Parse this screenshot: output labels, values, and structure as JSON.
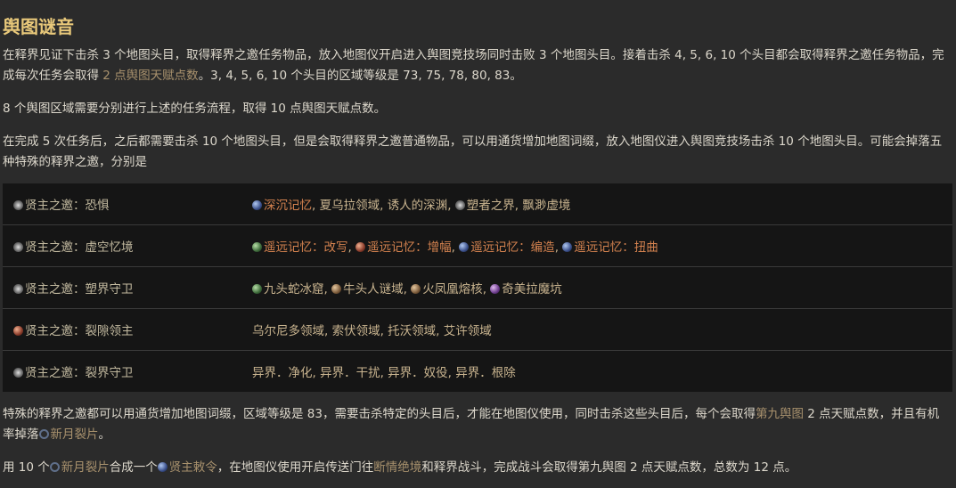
{
  "title": "舆图谜音",
  "para1": {
    "t1": "在释界见证下击杀 3 个地图头目，取得释界之邀任务物品，放入地图仪开启进入舆图竞技场同时击败 3 个地图头目。接着击杀 4, 5, 6, 10 个头目都会取得释界之邀任务物品，完成每次任务会取得 ",
    "hl": "2 点舆图天赋点数",
    "t2": "。3, 4, 5, 6, 10 个头目的区域等级是 73, 75, 78, 80, 83。"
  },
  "para2": "8 个舆图区域需要分别进行上述的任务流程，取得 10 点舆图天赋点数。",
  "para3": "在完成 5 次任务后，之后都需要击杀 10 个地图头目，但是会取得释界之邀普通物品，可以用通货增加地图词缀，放入地图仪进入舆图竞技场击杀 10 个地图头目。可能会掉落五种特殊的释界之邀，分别是",
  "table": {
    "rows": [
      {
        "name": "贤主之邀：恐惧",
        "items": [
          {
            "text": "深沉记忆",
            "style": "orange",
            "icon": "blue"
          },
          {
            "text": ", ",
            "style": "plain",
            "icon": ""
          },
          {
            "text": "夏乌拉领域",
            "style": "plain",
            "icon": ""
          },
          {
            "text": ", ",
            "style": "plain",
            "icon": ""
          },
          {
            "text": "诱人的深渊",
            "style": "plain",
            "icon": ""
          },
          {
            "text": ", ",
            "style": "plain",
            "icon": ""
          },
          {
            "text": "塑者之界",
            "style": "plain",
            "icon": "star"
          },
          {
            "text": ", ",
            "style": "plain",
            "icon": ""
          },
          {
            "text": "飘渺虚境",
            "style": "plain",
            "icon": ""
          }
        ]
      },
      {
        "name": "贤主之邀：虚空忆境",
        "items": [
          {
            "text": "遥远记忆：改写",
            "style": "orange",
            "icon": "green"
          },
          {
            "text": ", ",
            "style": "plain",
            "icon": ""
          },
          {
            "text": "遥远记忆：增幅",
            "style": "orange",
            "icon": "red"
          },
          {
            "text": ", ",
            "style": "plain",
            "icon": ""
          },
          {
            "text": "遥远记忆：编造",
            "style": "orange",
            "icon": "blue"
          },
          {
            "text": ", ",
            "style": "plain",
            "icon": ""
          },
          {
            "text": "遥远记忆：扭曲",
            "style": "orange",
            "icon": "blue"
          }
        ]
      },
      {
        "name": "贤主之邀：塑界守卫",
        "items": [
          {
            "text": "九头蛇冰窟",
            "style": "plain",
            "icon": "green"
          },
          {
            "text": ", ",
            "style": "plain",
            "icon": ""
          },
          {
            "text": "牛头人谜域",
            "style": "plain",
            "icon": "brown"
          },
          {
            "text": ", ",
            "style": "plain",
            "icon": ""
          },
          {
            "text": "火凤凰熔核",
            "style": "plain",
            "icon": "brown"
          },
          {
            "text": ", ",
            "style": "plain",
            "icon": ""
          },
          {
            "text": "奇美拉魔坑",
            "style": "plain",
            "icon": "purple"
          }
        ]
      },
      {
        "name": "贤主之邀：裂隙领主",
        "items": [
          {
            "text": "乌尔尼多领域, 索伏领域, 托沃领域, 艾许领域",
            "style": "plain",
            "icon": ""
          }
        ]
      },
      {
        "name": "贤主之邀：裂界守卫",
        "items": [
          {
            "text": "异界．净化, 异界．干扰, 异界．奴役, 异界．根除",
            "style": "plain",
            "icon": ""
          }
        ]
      }
    ],
    "row_icons": [
      "gray",
      "gray",
      "gray",
      "red",
      "gray"
    ]
  },
  "para4": {
    "t1": "特殊的释界之邀都可以用通货增加地图词缀，区域等级是 83，需要击杀特定的头目后，才能在地图仪使用，同时击杀这些头目后，每个会取得",
    "link1": "第九舆图",
    "t2": " 2 点天赋点数，并且有机率掉落",
    "link2": "新月裂片",
    "t3": "。"
  },
  "para5": {
    "t1": "用 10 个",
    "link1": "新月裂片",
    "t2": "合成一个",
    "link2": "贤主敕令",
    "t3": "，在地图仪使用开启传送门往",
    "link3": "断情绝境",
    "t4": "和释界战斗，完成战斗会取得第九舆图 2 点天赋点数，总数为 12 点。"
  },
  "colors": {
    "background": "#2b2b2b",
    "title": "#e8c87a",
    "highlight": "#a8916d",
    "orange_link": "#d4824f",
    "table_bg": "#151515"
  }
}
